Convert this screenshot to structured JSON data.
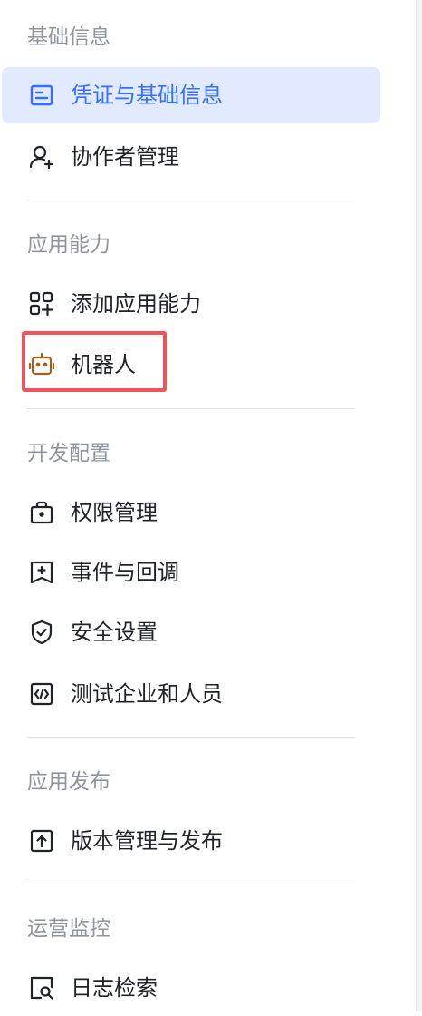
{
  "sections": {
    "basic": {
      "title": "基础信息",
      "items": {
        "credentials": {
          "label": "凭证与基础信息"
        },
        "collaborators": {
          "label": "协作者管理"
        }
      }
    },
    "capabilities": {
      "title": "应用能力",
      "items": {
        "add_capability": {
          "label": "添加应用能力"
        },
        "bot": {
          "label": "机器人"
        }
      }
    },
    "dev": {
      "title": "开发配置",
      "items": {
        "permissions": {
          "label": "权限管理"
        },
        "events": {
          "label": "事件与回调"
        },
        "security": {
          "label": "安全设置"
        },
        "test_org": {
          "label": "测试企业和人员"
        }
      }
    },
    "release": {
      "title": "应用发布",
      "items": {
        "version": {
          "label": "版本管理与发布"
        }
      }
    },
    "ops": {
      "title": "运营监控",
      "items": {
        "logs": {
          "label": "日志检索"
        }
      }
    }
  },
  "colors": {
    "active_bg": "#e1eaff",
    "active_text": "#3370ff",
    "bot_icon": "#a0621f",
    "highlight": "#f0545a"
  }
}
